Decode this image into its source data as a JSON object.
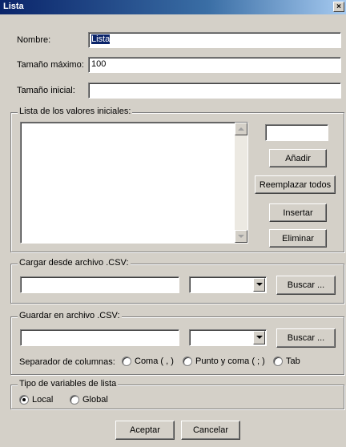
{
  "window": {
    "title": "Lista",
    "close_glyph": "×"
  },
  "fields": {
    "nombre": {
      "label": "Nombre:",
      "value": "Lista"
    },
    "tamano_maximo": {
      "label": "Tamaño máximo:",
      "value": "100"
    },
    "tamano_inicial": {
      "label": "Tamaño inicial:",
      "value": ""
    }
  },
  "valores": {
    "title": "Lista de los valores iniciales:",
    "input_value": "",
    "buttons": {
      "anadir": "Añadir",
      "reemplazar": "Reemplazar todos",
      "insertar": "Insertar",
      "eliminar": "Eliminar"
    }
  },
  "cargar": {
    "title": "Cargar desde archivo .CSV:",
    "path_value": "",
    "select_value": "",
    "buscar": "Buscar ..."
  },
  "guardar": {
    "title": "Guardar en archivo .CSV:",
    "path_value": "",
    "select_value": "",
    "buscar": "Buscar ...",
    "separator_label": "Separador de columnas:",
    "separators": [
      {
        "label": "Coma ( , )",
        "checked": false
      },
      {
        "label": "Punto y coma ( ; )",
        "checked": false
      },
      {
        "label": "Tab",
        "checked": false
      }
    ]
  },
  "tipo": {
    "title": "Tipo de variables de lista",
    "options": [
      {
        "label": "Local",
        "checked": true
      },
      {
        "label": "Global",
        "checked": false
      }
    ]
  },
  "footer": {
    "aceptar": "Aceptar",
    "cancelar": "Cancelar"
  },
  "colors": {
    "titlebar_start": "#0a246a",
    "titlebar_end": "#a6caf0",
    "face": "#d4d0c8",
    "selection": "#0a246a"
  },
  "icons": {
    "close": "close-icon",
    "dropdown": "chevron-down-icon",
    "scroll_up": "scroll-up-icon",
    "scroll_down": "scroll-down-icon"
  }
}
